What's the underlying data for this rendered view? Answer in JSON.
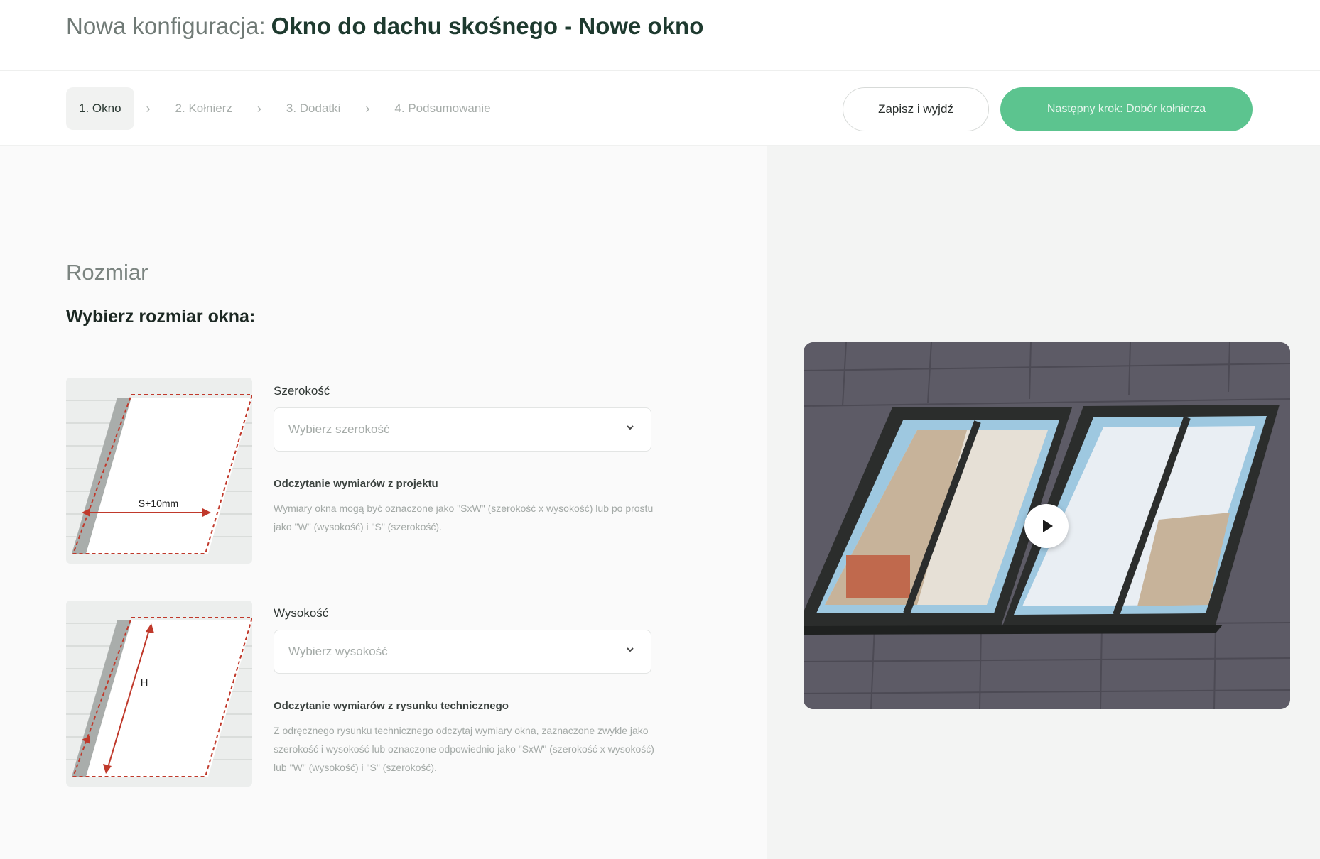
{
  "header": {
    "title_prefix": "Nowa konfiguracja:",
    "title_main": "Okno do dachu skośnego - Nowe okno"
  },
  "steps": [
    {
      "label": "1. Okno",
      "active": true
    },
    {
      "label": "2. Kołnierz",
      "active": false
    },
    {
      "label": "3. Dodatki",
      "active": false
    },
    {
      "label": "4. Podsumowanie",
      "active": false
    }
  ],
  "actions": {
    "save_label": "Zapisz i wyjdź",
    "next_label": "Następny krok: Dobór kołnierza"
  },
  "section": {
    "label": "Rozmiar",
    "heading": "Wybierz rozmiar okna:"
  },
  "width": {
    "label": "Szerokość",
    "placeholder": "Wybierz szerokość",
    "help_title": "Odczytanie wymiarów z projektu",
    "help_text": "Wymiary okna mogą być oznaczone jako \"SxW\" (szerokość x wysokość) lub po prostu jako \"W\" (wysokość) i \"S\" (szerokość).",
    "diagram_label": "S+10mm"
  },
  "height": {
    "label": "Wysokość",
    "placeholder": "Wybierz wysokość",
    "help_title": "Odczytanie wymiarów z rysunku technicznego",
    "help_text": "Z odręcznego rysunku technicznego odczytaj wymiary okna, zaznaczone zwykle jako szerokość i wysokość lub oznaczone odpowiednio jako \"SxW\" (szerokość x wysokość) lub \"W\" (wysokość) i \"S\" (szerokość).",
    "diagram_label": "H"
  },
  "colors": {
    "accent": "#5cc48f",
    "dimension": "#c0392b"
  },
  "icons": {
    "step_separator": "chevron-right-icon",
    "select": "chevron-down-icon",
    "video": "play-icon"
  }
}
